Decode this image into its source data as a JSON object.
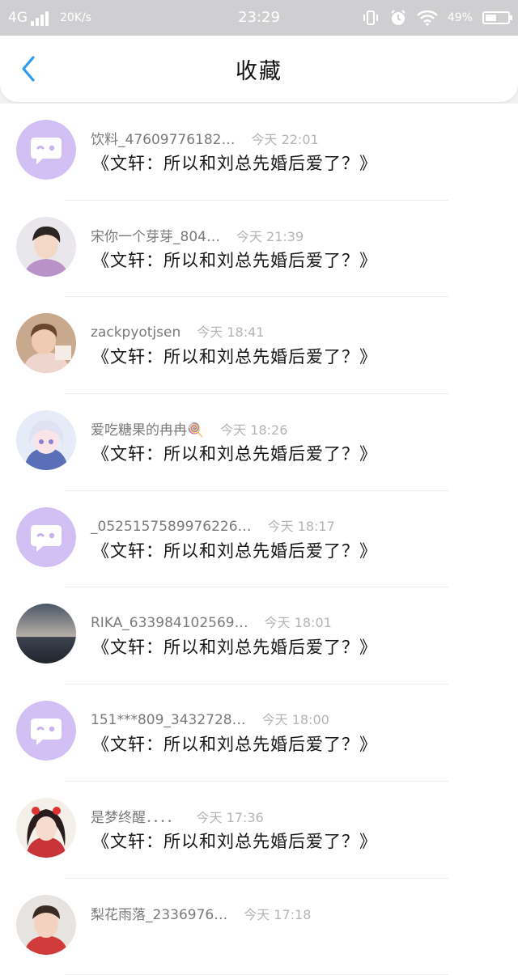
{
  "status_bar": {
    "network": "4G",
    "speed": "20K/s",
    "time": "23:29",
    "battery": "49%",
    "battery_level": 0.49
  },
  "header": {
    "title": "收藏"
  },
  "items": [
    {
      "username": "饮料_47609776182…",
      "time": "今天 22:01",
      "message": "《文轩：所以和刘总先婚后爱了？》",
      "avatar": "chat-default-icon"
    },
    {
      "username": "宋你一个芽芽_804…",
      "time": "今天 21:39",
      "message": "《文轩：所以和刘总先婚后爱了？》",
      "avatar": "user-photo-boy"
    },
    {
      "username": "zackpyotjsen",
      "time": "今天 18:41",
      "message": "《文轩：所以和刘总先婚后爱了？》",
      "avatar": "user-photo-child"
    },
    {
      "username": "爱吃糖果的冉冉🍭",
      "time": "今天 18:26",
      "message": "《文轩：所以和刘总先婚后爱了？》",
      "avatar": "user-photo-anime"
    },
    {
      "username": "_0525157589976226…",
      "time": "今天 18:17",
      "message": "《文轩：所以和刘总先婚后爱了？》",
      "avatar": "chat-default-icon"
    },
    {
      "username": "RIKA_633984102569…",
      "time": "今天 18:01",
      "message": "《文轩：所以和刘总先婚后爱了？》",
      "avatar": "user-photo-sunset"
    },
    {
      "username": "151***809_3432728…",
      "time": "今天 18:00",
      "message": "《文轩：所以和刘总先婚后爱了？》",
      "avatar": "chat-default-icon"
    },
    {
      "username": "是梦终醒．．．．",
      "time": "今天 17:36",
      "message": "《文轩：所以和刘总先婚后爱了？》",
      "avatar": "user-photo-girl"
    },
    {
      "username": "梨花雨落_2336976…",
      "time": "今天 17:18",
      "message": "",
      "avatar": "user-photo-boy2"
    }
  ],
  "colors": {
    "status_bar_bg": "#cfcfd1",
    "accent_blue": "#2f9bf0",
    "default_avatar_bg": "#d2bff3",
    "page_bg": "#f2f2f4"
  }
}
